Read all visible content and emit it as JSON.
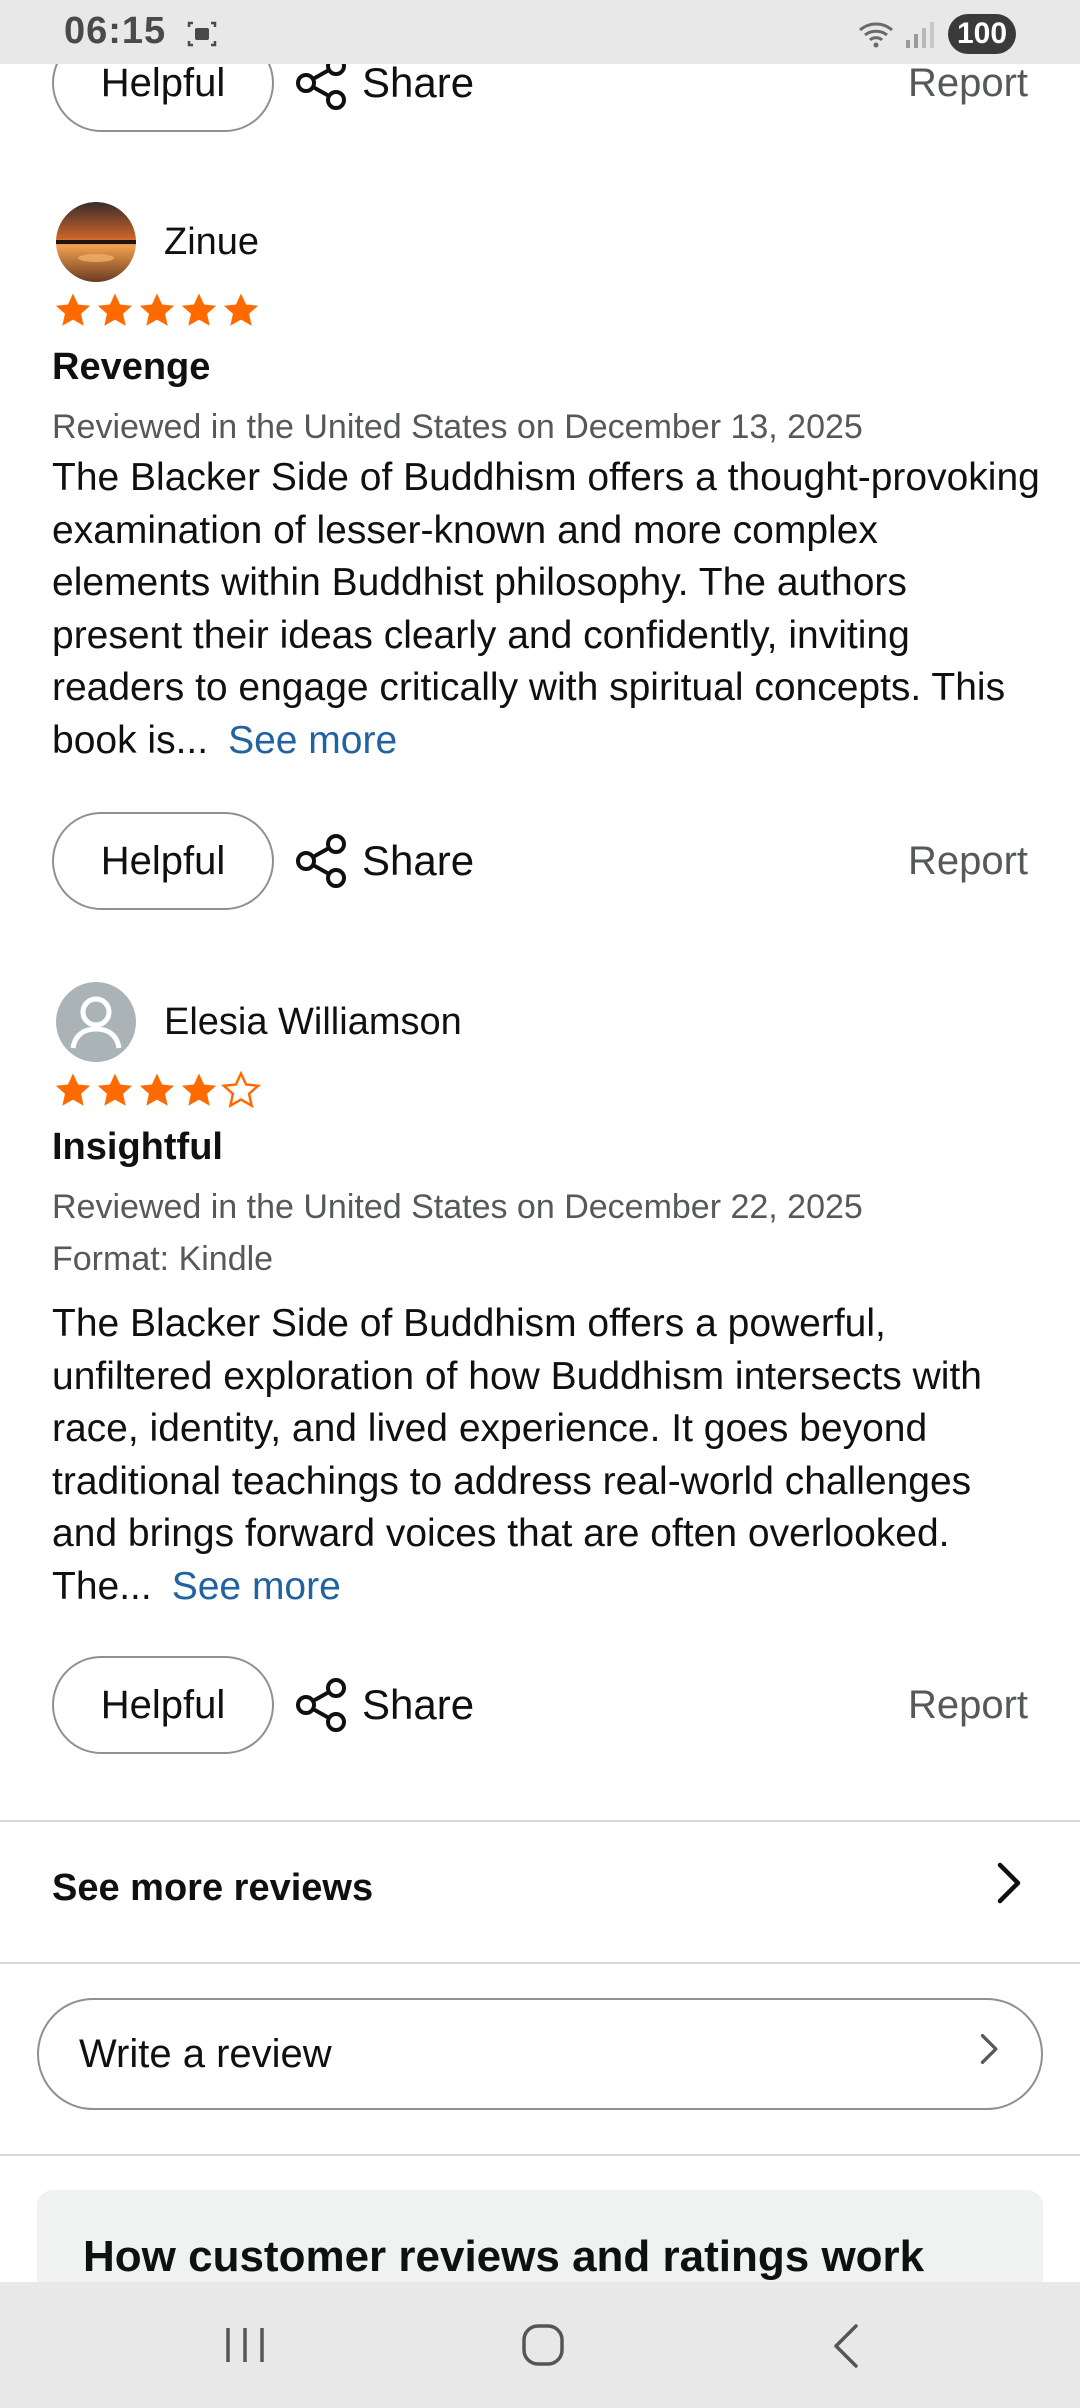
{
  "status_bar": {
    "time": "06:15",
    "battery": "100"
  },
  "actions": {
    "helpful": "Helpful",
    "share": "Share",
    "report": "Report"
  },
  "reviews": [
    {
      "reviewer": "Zinue",
      "rating": 5,
      "title": "Revenge",
      "date_line": "Reviewed in the United States on December 13, 2025",
      "format": "",
      "body": "The Blacker Side of Buddhism offers a thought-provoking examination of lesser-known and more complex elements within Buddhist philosophy. The authors present their ideas clearly and confidently, inviting readers to engage critically with spiritual concepts. This book is...",
      "see_more": "See more"
    },
    {
      "reviewer": "Elesia Williamson",
      "rating": 4,
      "title": "Insightful",
      "date_line": "Reviewed in the United States on December 22, 2025",
      "format": "Format: Kindle",
      "body": "The Blacker Side of Buddhism offers a powerful, unfiltered exploration of how Buddhism intersects with race, identity, and lived experience. It goes beyond traditional teachings to address real-world challenges and brings forward voices that are often overlooked. The...",
      "see_more": "See more"
    }
  ],
  "see_more_reviews": "See more reviews",
  "write_review": "Write a review",
  "info_card_title": "How customer reviews and ratings work",
  "colors": {
    "star": "#ff6a00",
    "link": "#2162a1",
    "muted": "#565959"
  }
}
